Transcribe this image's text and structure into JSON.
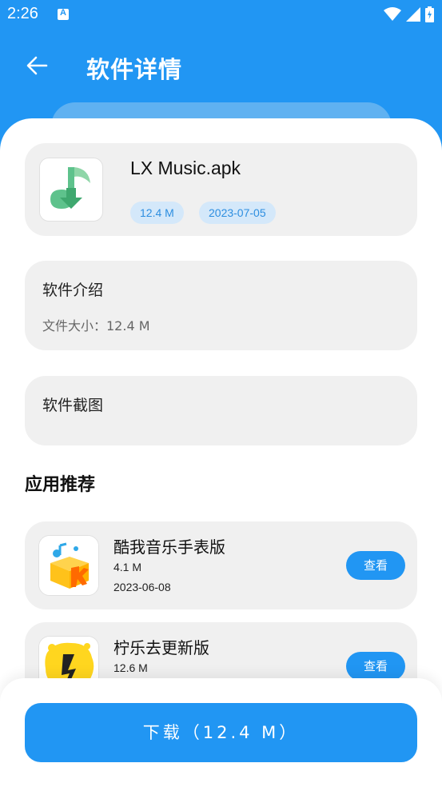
{
  "status_bar": {
    "time": "2:26",
    "icons": [
      "notification-a-icon",
      "wifi-icon",
      "signal-icon",
      "battery-icon"
    ]
  },
  "app_bar": {
    "title": "软件详情",
    "back_icon": "back-arrow-icon"
  },
  "file": {
    "name": "LX Music.apk",
    "size": "12.4 M",
    "date": "2023-07-05",
    "icon": "lx-music-icon"
  },
  "intro": {
    "title": "软件介绍",
    "file_size_text": "文件大小：12.4 M"
  },
  "screenshots": {
    "title": "软件截图"
  },
  "recommend": {
    "title": "应用推荐",
    "items": [
      {
        "name": "酷我音乐手表版",
        "size": "4.1 M",
        "date": "2023-06-08",
        "button": "查看",
        "icon": "kuwo-music-icon"
      },
      {
        "name": "柠乐去更新版",
        "size": "12.6 M",
        "date": "",
        "button": "查看",
        "icon": "ningle-icon"
      }
    ]
  },
  "download": {
    "label": "下载（12.4 M）"
  },
  "colors": {
    "primary": "#2196f3",
    "card_bg": "#f0f0f0",
    "tag_bg": "#d4e8fa",
    "tag_text": "#2d8ee0"
  }
}
